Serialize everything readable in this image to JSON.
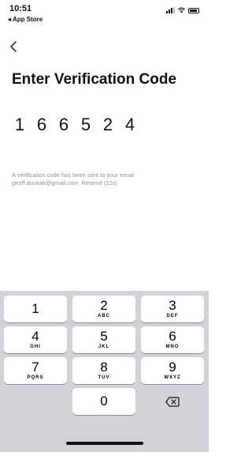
{
  "status_bar": {
    "time": "10:51",
    "back_app": "◂ App Store"
  },
  "page": {
    "title": "Enter Verification Code",
    "code_digits": [
      "1",
      "6",
      "6",
      "5",
      "2",
      "4"
    ],
    "info_line1": "A verification code has been sent to your email",
    "email": "geoff.dunkak@gmail.com",
    "resend_label": "Resend (22s)"
  },
  "keyboard": {
    "keys": [
      {
        "num": "1",
        "letters": ""
      },
      {
        "num": "2",
        "letters": "ABC"
      },
      {
        "num": "3",
        "letters": "DEF"
      },
      {
        "num": "4",
        "letters": "GHI"
      },
      {
        "num": "5",
        "letters": "JKL"
      },
      {
        "num": "6",
        "letters": "MNO"
      },
      {
        "num": "7",
        "letters": "PQRS"
      },
      {
        "num": "8",
        "letters": "TUV"
      },
      {
        "num": "9",
        "letters": "WXYZ"
      },
      {
        "num": "0",
        "letters": ""
      }
    ]
  },
  "icons": {
    "back": "chevron-left-icon",
    "delete": "backspace-icon"
  }
}
